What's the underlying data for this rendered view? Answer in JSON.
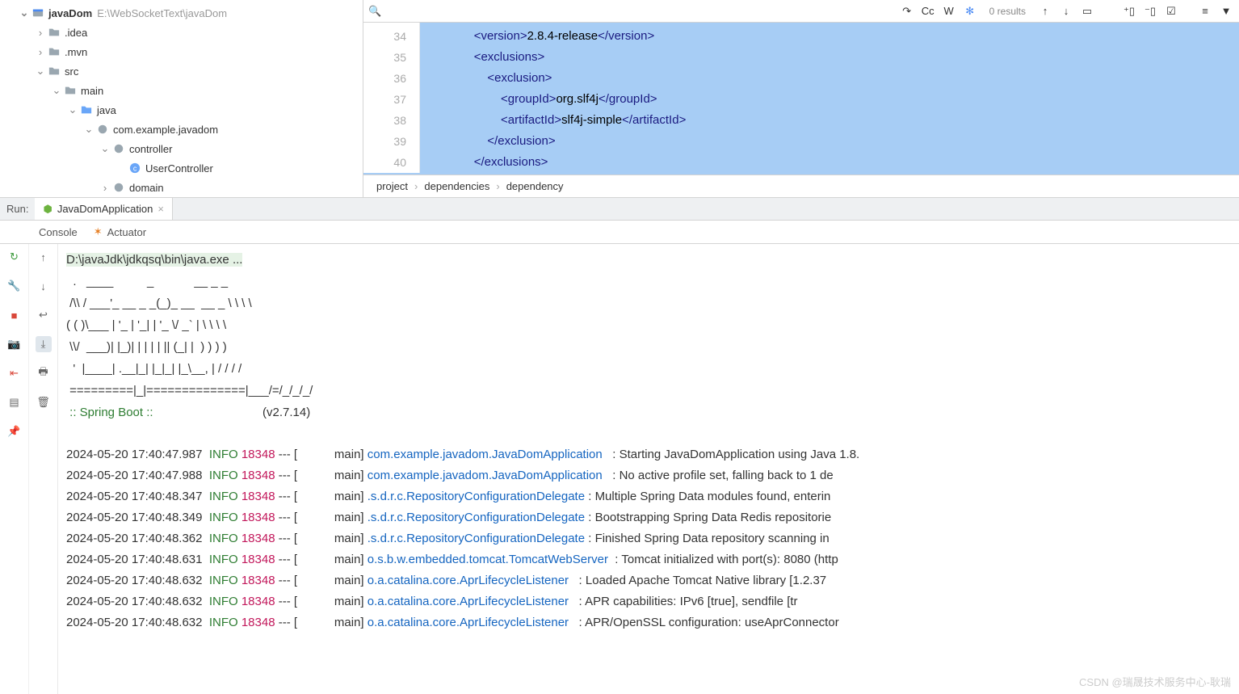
{
  "project": {
    "name": "javaDom",
    "path": "E:\\WebSocketText\\javaDom",
    "tree": {
      "idea": ".idea",
      "mvn": ".mvn",
      "src": "src",
      "main": "main",
      "java": "java",
      "package": "com.example.javadom",
      "controller": "controller",
      "userController": "UserController",
      "domain": "domain"
    }
  },
  "search": {
    "results": "0 results"
  },
  "code": {
    "lines": [
      34,
      35,
      36,
      37,
      38,
      39,
      40
    ],
    "l34a": "<",
    "l34b": "version",
    "l34c": ">",
    "l34d": "2.8.4-release",
    "l34e": "</",
    "l34f": "version",
    "l34g": ">",
    "l35a": "<",
    "l35b": "exclusions",
    "l35c": ">",
    "l36a": "<",
    "l36b": "exclusion",
    "l36c": ">",
    "l37a": "<",
    "l37b": "groupId",
    "l37c": ">",
    "l37d": "org.slf4j",
    "l37e": "</",
    "l37f": "groupId",
    "l37g": ">",
    "l38a": "<",
    "l38b": "artifactId",
    "l38c": ">",
    "l38d": "slf4j-simple",
    "l38e": "</",
    "l38f": "artifactId",
    "l38g": ">",
    "l39a": "</",
    "l39b": "exclusion",
    "l39c": ">",
    "l40a": "</",
    "l40b": "exclusions",
    "l40c": ">"
  },
  "breadcrumb": {
    "b1": "project",
    "b2": "dependencies",
    "b3": "dependency"
  },
  "run": {
    "label": "Run:",
    "app": "JavaDomApplication",
    "tabs": {
      "console": "Console",
      "actuator": "Actuator"
    }
  },
  "console": {
    "cmd": "D:\\javaJdk\\jdkqsq\\bin\\java.exe ...",
    "banner": "  .   ____          _            __ _ _\n /\\\\ / ___'_ __ _ _(_)_ __  __ _ \\ \\ \\ \\\n( ( )\\___ | '_ | '_| | '_ \\/ _` | \\ \\ \\ \\\n \\\\/  ___)| |_)| | | | | || (_| |  ) ) ) )\n  '  |____| .__|_| |_|_| |_\\__, | / / / /\n =========|_|==============|___/=/_/_/_/",
    "spring": " :: Spring Boot ::",
    "version": "(v2.7.14)",
    "logs": [
      {
        "ts": "2024-05-20 17:40:47.987",
        "lvl": "INFO",
        "pid": "18348",
        "thr": "main",
        "cls": "com.example.javadom.JavaDomApplication",
        "msg": "Starting JavaDomApplication using Java 1.8."
      },
      {
        "ts": "2024-05-20 17:40:47.988",
        "lvl": "INFO",
        "pid": "18348",
        "thr": "main",
        "cls": "com.example.javadom.JavaDomApplication",
        "msg": "No active profile set, falling back to 1 de"
      },
      {
        "ts": "2024-05-20 17:40:48.347",
        "lvl": "INFO",
        "pid": "18348",
        "thr": "main",
        "cls": ".s.d.r.c.RepositoryConfigurationDelegate",
        "msg": "Multiple Spring Data modules found, enterin"
      },
      {
        "ts": "2024-05-20 17:40:48.349",
        "lvl": "INFO",
        "pid": "18348",
        "thr": "main",
        "cls": ".s.d.r.c.RepositoryConfigurationDelegate",
        "msg": "Bootstrapping Spring Data Redis repositorie"
      },
      {
        "ts": "2024-05-20 17:40:48.362",
        "lvl": "INFO",
        "pid": "18348",
        "thr": "main",
        "cls": ".s.d.r.c.RepositoryConfigurationDelegate",
        "msg": "Finished Spring Data repository scanning in"
      },
      {
        "ts": "2024-05-20 17:40:48.631",
        "lvl": "INFO",
        "pid": "18348",
        "thr": "main",
        "cls": "o.s.b.w.embedded.tomcat.TomcatWebServer",
        "msg": "Tomcat initialized with port(s): 8080 (http"
      },
      {
        "ts": "2024-05-20 17:40:48.632",
        "lvl": "INFO",
        "pid": "18348",
        "thr": "main",
        "cls": "o.a.catalina.core.AprLifecycleListener",
        "msg": "Loaded Apache Tomcat Native library [1.2.37"
      },
      {
        "ts": "2024-05-20 17:40:48.632",
        "lvl": "INFO",
        "pid": "18348",
        "thr": "main",
        "cls": "o.a.catalina.core.AprLifecycleListener",
        "msg": "APR capabilities: IPv6 [true], sendfile [tr"
      },
      {
        "ts": "2024-05-20 17:40:48.632",
        "lvl": "INFO",
        "pid": "18348",
        "thr": "main",
        "cls": "o.a.catalina.core.AprLifecycleListener",
        "msg": "APR/OpenSSL configuration: useAprConnector"
      }
    ]
  },
  "watermark": "CSDN @瑞晟技术服务中心-耿瑞"
}
